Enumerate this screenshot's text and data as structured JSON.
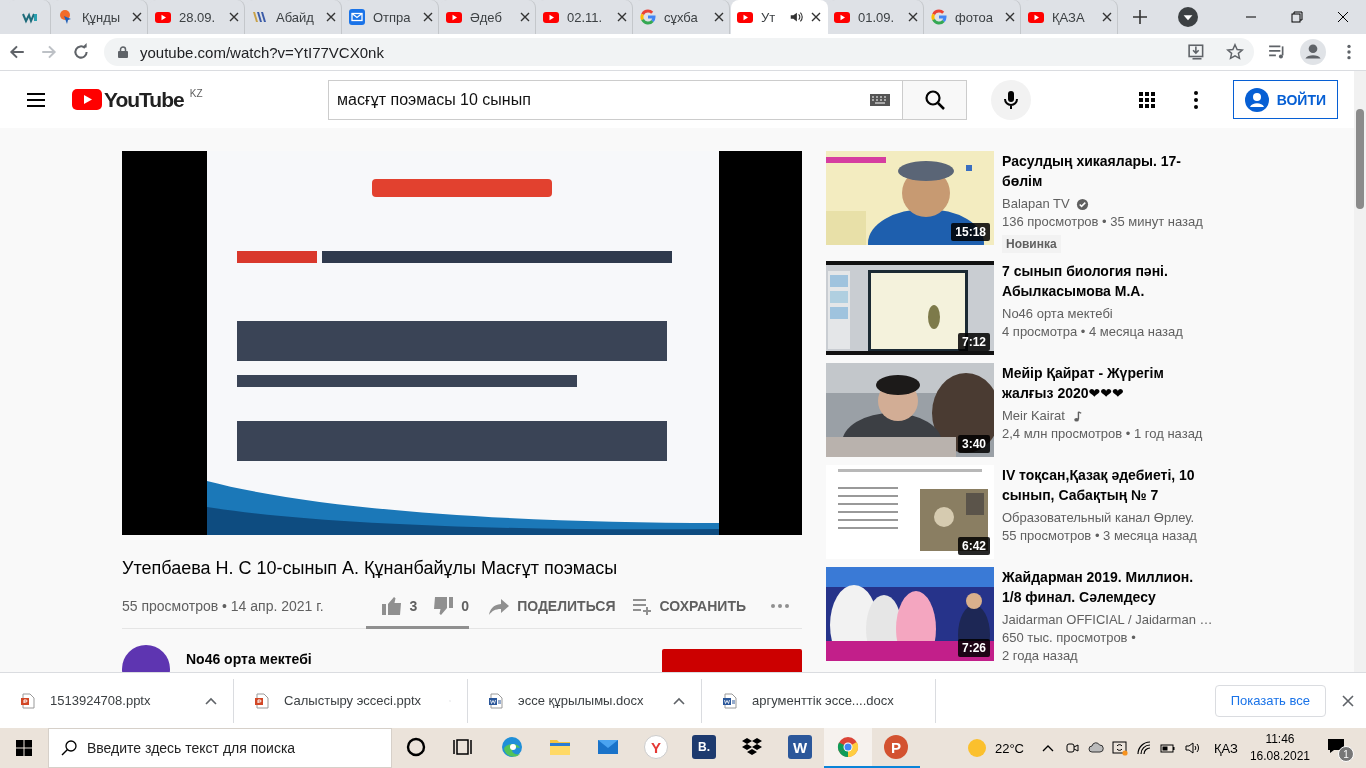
{
  "browser": {
    "tabs": [
      {
        "kind": "site",
        "selected": false,
        "audio": false
      },
      {
        "kind": "pin",
        "title": "Құнды",
        "selected": false,
        "audio": false
      },
      {
        "kind": "video",
        "title": "28.09.",
        "selected": false,
        "audio": false
      },
      {
        "kind": "books",
        "title": "Абайд",
        "selected": false,
        "audio": false
      },
      {
        "kind": "mail",
        "title": "Отпра",
        "selected": false,
        "audio": false
      },
      {
        "kind": "video",
        "title": "Әдеб",
        "selected": false,
        "audio": false
      },
      {
        "kind": "video",
        "title": "02.11.",
        "selected": false,
        "audio": false
      },
      {
        "kind": "search",
        "title": "сұхба",
        "selected": false,
        "audio": false
      },
      {
        "kind": "video",
        "title": "Ут",
        "selected": true,
        "audio": true
      },
      {
        "kind": "video",
        "title": "01.09.",
        "selected": false,
        "audio": false
      },
      {
        "kind": "search",
        "title": "фотоа",
        "selected": false,
        "audio": false
      },
      {
        "kind": "video",
        "title": "ҚАЗА",
        "selected": false,
        "audio": false
      }
    ],
    "url": "youtube.com/watch?v=YtI77VCX0nk"
  },
  "youtube": {
    "logo": "YouTube",
    "region": "KZ",
    "search": {
      "value": "масғұт поэмасы 10 сынып"
    },
    "sign_in": "ВОЙТИ"
  },
  "video": {
    "kind": "picture",
    "title": "Утепбаева Н. С 10-сынып А. Құнанбайұлы Масғұт поэмасы",
    "meta": "55 просмотров • 14 апр. 2021 г.",
    "likes": "3",
    "dislikes": "0",
    "sentiment": {
      "level": 1
    },
    "share": "ПОДЕЛИТЬСЯ",
    "save": "СОХРАНИТЬ",
    "channel": {
      "name": "No46 орта мектебі"
    }
  },
  "recommendations": [
    {
      "title": "Расулдың хикаялары. 17-бөлім",
      "channel": "Balapan TV",
      "kind": "verified",
      "meta": [
        "136 просмотров • 35 минут назад"
      ],
      "badge": "Новинка",
      "duration": "15:18"
    },
    {
      "title": "7 сынып биология пәні. Абылкасымова М.А.",
      "channel": "No46 орта мектебі",
      "kind": "plain",
      "meta": [
        "4 просмотра • 4 месяца назад"
      ],
      "duration": "7:12"
    },
    {
      "title": "Мейір Қайрат - Жүрегім жалғыз 2020❤❤❤",
      "channel": "Meir Kairat",
      "kind": "music",
      "meta": [
        "2,4 млн просмотров • 1 год назад"
      ],
      "duration": "3:40"
    },
    {
      "title": "IV тоқсан,Қазақ әдебиеті, 10 сынып, Сабақтың № 7",
      "channel": "Образовательный канал Өрлеу.",
      "kind": "plain",
      "meta": [
        "55 просмотров • 3 месяца назад"
      ],
      "duration": "6:42"
    },
    {
      "title": "Жайдарман 2019. Миллион. 1/8 финал. Сәлемдесу",
      "channel": "Jaidarman OFFICIAL / Jaidarman …",
      "kind": "plain",
      "meta": [
        "650 тыс. просмотров •",
        "2 года назад"
      ],
      "duration": "7:26"
    }
  ],
  "downloads": {
    "items": [
      {
        "file": "1513924708.pptx",
        "kind": "slides"
      },
      {
        "file": "Салыстыру эссесі.pptx",
        "kind": "slides"
      },
      {
        "file": "эссе құрылымы.docx",
        "kind": "document"
      },
      {
        "file": "аргументтік эссе....docx",
        "kind": "document"
      }
    ],
    "show_all": "Показать все"
  },
  "taskbar": {
    "search_placeholder": "Введите здесь текст для поиска",
    "apps": [
      {
        "kind": "cortana",
        "running": false,
        "selected": false
      },
      {
        "kind": "task-view",
        "running": false,
        "selected": false
      },
      {
        "kind": "edge",
        "running": false,
        "selected": false
      },
      {
        "kind": "explorer",
        "running": false,
        "selected": false
      },
      {
        "kind": "mail",
        "running": false,
        "selected": false
      },
      {
        "kind": "yandex",
        "glyph": "Y",
        "running": false,
        "selected": false
      },
      {
        "kind": "bitrix",
        "glyph": "B.",
        "running": false,
        "selected": false
      },
      {
        "kind": "dropbox",
        "running": false,
        "selected": false
      },
      {
        "kind": "word",
        "glyph": "W",
        "running": false,
        "selected": false
      },
      {
        "kind": "chrome",
        "running": true,
        "selected": true
      },
      {
        "kind": "powerpoint",
        "glyph": "P",
        "running": true,
        "selected": false
      }
    ],
    "temperature": "22°C",
    "language": "ҚАЗ",
    "time": "11:46",
    "date": "16.08.2021",
    "notifications": "1"
  }
}
